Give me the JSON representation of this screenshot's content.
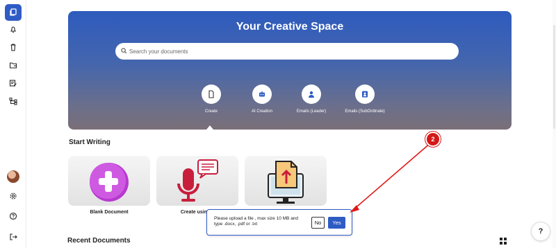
{
  "sidebar": {
    "items": [
      {
        "icon": "documents-icon",
        "active": true
      },
      {
        "icon": "notification-icon",
        "active": false
      },
      {
        "icon": "trash-icon",
        "active": false
      },
      {
        "icon": "folder-icon",
        "active": false
      },
      {
        "icon": "edit-note-icon",
        "active": false
      },
      {
        "icon": "hierarchy-icon",
        "active": false
      }
    ],
    "bottom_items": [
      {
        "icon": "settings-icon"
      },
      {
        "icon": "help-circle-icon"
      },
      {
        "icon": "logout-icon"
      }
    ]
  },
  "hero": {
    "title": "Your Creative Space",
    "search_placeholder": "Search your documents",
    "options": [
      {
        "label": "Create",
        "icon": "file-icon"
      },
      {
        "label": "AI Creation",
        "icon": "robot-icon"
      },
      {
        "label": "Emails (Leader)",
        "icon": "person-icon"
      },
      {
        "label": "Emails (SubOrdinate)",
        "icon": "id-badge-icon"
      }
    ]
  },
  "start_writing": {
    "title": "Start Writing",
    "cards": [
      {
        "label": "Blank Document",
        "icon": "plus-icon"
      },
      {
        "label": "Create using s",
        "icon": "microphone-icon"
      },
      {
        "label": "",
        "icon": "upload-file-icon"
      }
    ]
  },
  "popup": {
    "message": "Please upload a file , max size 10 MB and type .docx, .pdf or .txt",
    "no_label": "No",
    "yes_label": "Yes"
  },
  "annotation": {
    "step": "2",
    "color": "#d41818"
  },
  "recent": {
    "title": "Recent Documents"
  },
  "help": {
    "label": "?"
  },
  "colors": {
    "accent": "#2f5bc4",
    "plus": "#c43ad6",
    "mic": "#c81e3c"
  }
}
